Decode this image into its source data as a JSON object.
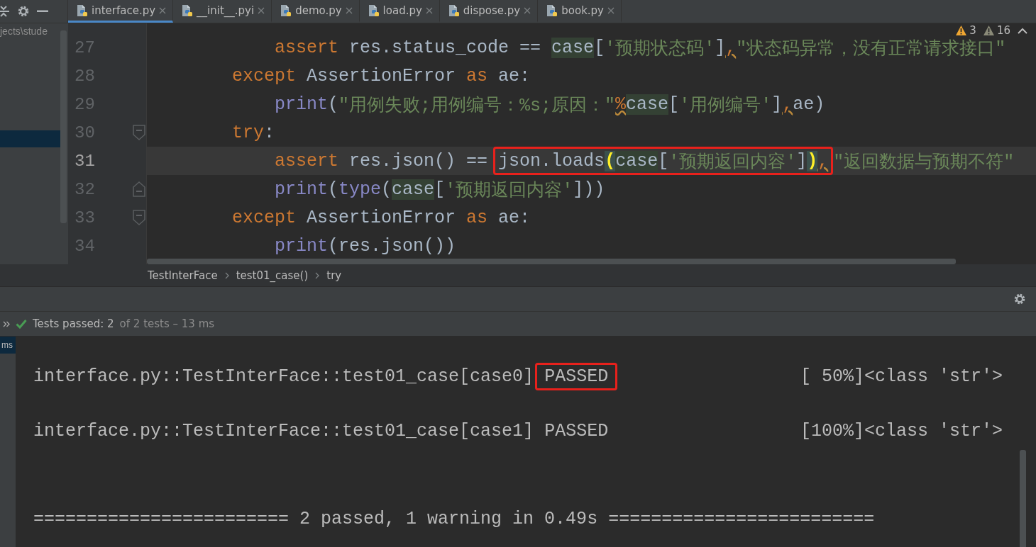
{
  "tabs": [
    {
      "label": "interface.py",
      "selected": true
    },
    {
      "label": "__init__.pyi",
      "selected": false
    },
    {
      "label": "demo.py",
      "selected": false
    },
    {
      "label": "load.py",
      "selected": false
    },
    {
      "label": "dispose.py",
      "selected": false
    },
    {
      "label": "book.py",
      "selected": false
    }
  ],
  "project_panel": {
    "path": "jects\\stude"
  },
  "inspections": {
    "warnings": "3",
    "weak_warnings": "16"
  },
  "editor": {
    "lines": [
      {
        "number": "27",
        "current": false,
        "tokens": [
          {
            "text": "            assert",
            "kind": "keyword"
          },
          {
            "text": " res.status_code == ",
            "kind": "plain"
          },
          {
            "text": "case",
            "kind": "match"
          },
          {
            "text": "[",
            "kind": "plain"
          },
          {
            "text": "'预期状态码'",
            "kind": "string"
          },
          {
            "text": "]",
            "kind": "plain"
          },
          {
            "text": ",",
            "kind": "weak"
          },
          {
            "text": "\"状态码异常，没有正常请求接口\"",
            "kind": "string"
          }
        ]
      },
      {
        "number": "28",
        "current": false,
        "tokens": [
          {
            "text": "        except",
            "kind": "keyword"
          },
          {
            "text": " AssertionError ",
            "kind": "plain"
          },
          {
            "text": "as",
            "kind": "keyword"
          },
          {
            "text": " ae:",
            "kind": "plain"
          }
        ]
      },
      {
        "number": "29",
        "current": false,
        "tokens": [
          {
            "text": "            print",
            "kind": "builtin"
          },
          {
            "text": "(",
            "kind": "plain"
          },
          {
            "text": "\"用例失败;用例编号：%s;原因：\"",
            "kind": "string"
          },
          {
            "text": "%",
            "kind": "weak"
          },
          {
            "text": "case",
            "kind": "match"
          },
          {
            "text": "[",
            "kind": "plain"
          },
          {
            "text": "'用例编号'",
            "kind": "string"
          },
          {
            "text": "]",
            "kind": "plain"
          },
          {
            "text": ",",
            "kind": "weak"
          },
          {
            "text": "ae)",
            "kind": "plain"
          }
        ]
      },
      {
        "number": "30",
        "current": false,
        "fold_start": true,
        "tokens": [
          {
            "text": "        try",
            "kind": "keyword"
          },
          {
            "text": ":",
            "kind": "plain"
          }
        ]
      },
      {
        "number": "31",
        "current": true,
        "tokens": [
          {
            "text": "            assert",
            "kind": "keyword"
          },
          {
            "text": " res.json() == ",
            "kind": "plain"
          },
          {
            "kind": "frame",
            "tokens": [
              {
                "text": "json.loads",
                "kind": "plain"
              },
              {
                "text": "(",
                "kind": "brace"
              },
              {
                "text": "case",
                "kind": "match"
              },
              {
                "text": "[",
                "kind": "plain"
              },
              {
                "text": "'预期返回内容'",
                "kind": "string"
              },
              {
                "text": "]",
                "kind": "plain"
              },
              {
                "text": ")",
                "kind": "brace"
              },
              {
                "text": ",",
                "kind": "weak"
              }
            ]
          },
          {
            "text": "\"返回数据与预期不符\"",
            "kind": "string"
          }
        ]
      },
      {
        "number": "32",
        "current": false,
        "fold_end": true,
        "tokens": [
          {
            "text": "            print",
            "kind": "builtin"
          },
          {
            "text": "(",
            "kind": "plain"
          },
          {
            "text": "type",
            "kind": "builtin"
          },
          {
            "text": "(",
            "kind": "plain"
          },
          {
            "text": "case",
            "kind": "match"
          },
          {
            "text": "[",
            "kind": "plain"
          },
          {
            "text": "'预期返回内容'",
            "kind": "string"
          },
          {
            "text": "]))",
            "kind": "plain"
          }
        ]
      },
      {
        "number": "33",
        "current": false,
        "fold_start": true,
        "tokens": [
          {
            "text": "        except",
            "kind": "keyword"
          },
          {
            "text": " AssertionError ",
            "kind": "plain"
          },
          {
            "text": "as",
            "kind": "keyword"
          },
          {
            "text": " ae:",
            "kind": "plain"
          }
        ]
      },
      {
        "number": "34",
        "current": false,
        "tokens": [
          {
            "text": "            print",
            "kind": "builtin"
          },
          {
            "text": "(res.json())",
            "kind": "plain"
          }
        ]
      }
    ]
  },
  "breadcrumbs": [
    "TestInterFace",
    "test01_case()",
    "try"
  ],
  "run_status": {
    "passed": "Tests passed: 2",
    "detail": "of 2 tests – 13 ms"
  },
  "test_tree": {
    "item": "ms",
    "selected": true
  },
  "console": {
    "lines": [
      {
        "kind": "result",
        "test": "interface.py::TestInterFace::test01_case[case0]",
        "status": "PASSED",
        "framed": true,
        "progress": "[ 50%]<class 'str'>"
      },
      {
        "kind": "result",
        "test": "interface.py::TestInterFace::test01_case[case1]",
        "status": "PASSED",
        "framed": false,
        "progress": "[100%]<class 'str'>"
      },
      {
        "kind": "summary",
        "text": "======================== 2 passed, 1 warning in 0.49s ========================="
      }
    ]
  }
}
